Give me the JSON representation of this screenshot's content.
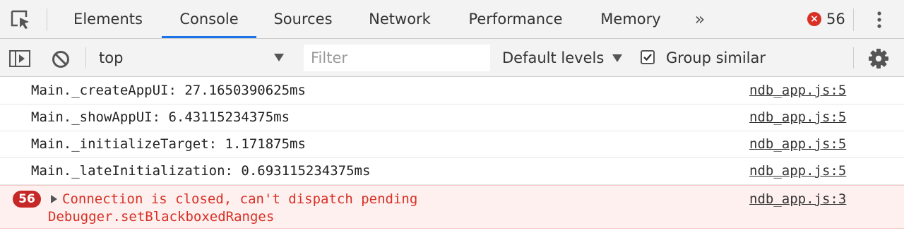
{
  "tabs": [
    {
      "label": "Elements"
    },
    {
      "label": "Console"
    },
    {
      "label": "Sources"
    },
    {
      "label": "Network"
    },
    {
      "label": "Performance"
    },
    {
      "label": "Memory"
    }
  ],
  "more_tabs_glyph": "»",
  "error_summary": {
    "icon_glyph": "×",
    "count": "56"
  },
  "toolbar": {
    "context": "top",
    "filter_placeholder": "Filter",
    "levels": "Default levels",
    "group_similar_label": "Group similar",
    "group_similar_checked": true
  },
  "messages": [
    {
      "text": "Main._createAppUI: 27.1650390625ms",
      "source": "ndb_app.js:5"
    },
    {
      "text": "Main._showAppUI: 6.43115234375ms",
      "source": "ndb_app.js:5"
    },
    {
      "text": "Main._initializeTarget: 1.171875ms",
      "source": "ndb_app.js:5"
    },
    {
      "text": "Main._lateInitialization: 0.693115234375ms",
      "source": "ndb_app.js:5"
    }
  ],
  "error_message": {
    "count": "56",
    "line1": "Connection is closed, can't dispatch pending",
    "line2": "Debugger.setBlackboxedRanges",
    "source": "ndb_app.js:3"
  },
  "colors": {
    "active_tab_underline": "#1a73e8",
    "error_red": "#d93025",
    "error_background": "#fdf0ef",
    "toolbar_background": "#f3f3f3"
  },
  "icons": [
    "inspect-element-icon",
    "more-tabs-icon",
    "error-icon",
    "kebab-menu-icon",
    "sidebar-toggle-icon",
    "clear-console-icon",
    "dropdown-arrow-icon",
    "checkbox-check-icon",
    "gear-icon",
    "expand-triangle-icon"
  ]
}
